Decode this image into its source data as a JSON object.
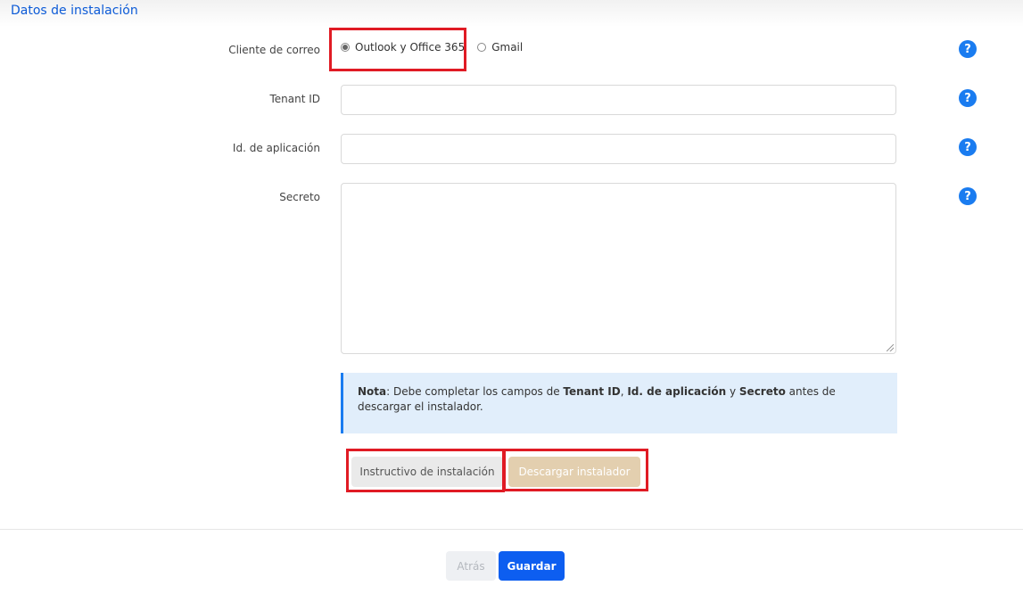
{
  "section": {
    "title": "Datos de instalación"
  },
  "form": {
    "mail_client_label": "Cliente de correo",
    "mail_options": [
      {
        "label": "Outlook y Office 365",
        "selected": true
      },
      {
        "label": "Gmail",
        "selected": false
      }
    ],
    "tenant_label": "Tenant ID",
    "tenant_value": "",
    "app_id_label": "Id. de aplicación",
    "app_id_value": "",
    "secret_label": "Secreto",
    "secret_value": ""
  },
  "help_icon": "?",
  "note": {
    "prefix": "Nota",
    "text1": ": Debe completar los campos de ",
    "f1": "Tenant ID",
    "sep1": ", ",
    "f2": "Id. de aplicación",
    "sep2": " y ",
    "f3": "Secreto",
    "text2": " antes de descargar el instalador."
  },
  "buttons": {
    "instructivo": "Instructivo de instalación",
    "descargar": "Descargar instalador",
    "atras": "Atrás",
    "guardar": "Guardar"
  },
  "colors": {
    "accent": "#0d5ef0",
    "highlight_box": "#e01b24",
    "note_bg": "#e1eefb",
    "download_button": "#e3cfaf"
  }
}
